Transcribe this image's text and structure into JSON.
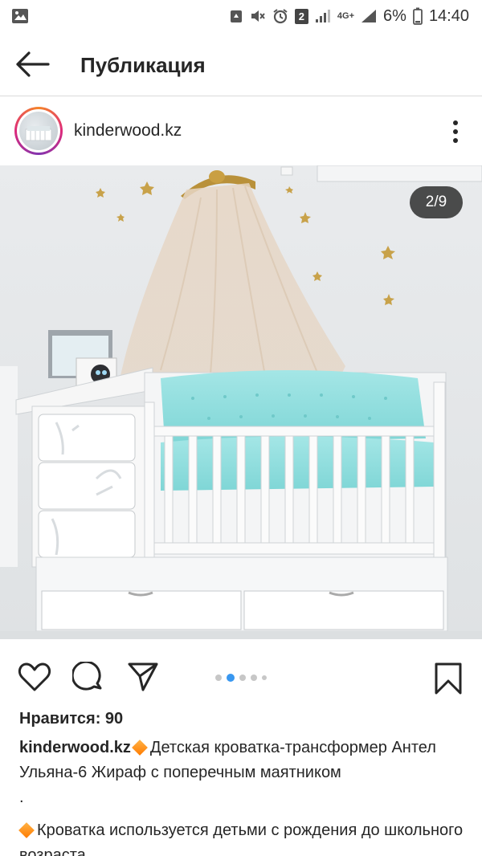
{
  "status_bar": {
    "signal_label": "2",
    "network": "4G+",
    "battery": "6%",
    "time": "14:40"
  },
  "app_bar": {
    "title": "Публикация"
  },
  "post": {
    "username": "kinderwood.kz",
    "image_counter": "2/9",
    "carousel": {
      "total_dots": 5,
      "active_index": 1
    },
    "likes": "Нравится: 90",
    "caption": {
      "username": "kinderwood.kz",
      "line1": "Детская кроватка-трансформер Антел Ульяна-6 Жираф с поперечным маятником",
      "line2": ".",
      "line3": "Кроватка используется детьми с рождения до школьного возраста."
    }
  },
  "icons": {
    "back": "arrow-left-icon",
    "more": "more-vertical-icon",
    "like": "heart-icon",
    "comment": "comment-icon",
    "share": "send-icon",
    "save": "bookmark-icon"
  }
}
